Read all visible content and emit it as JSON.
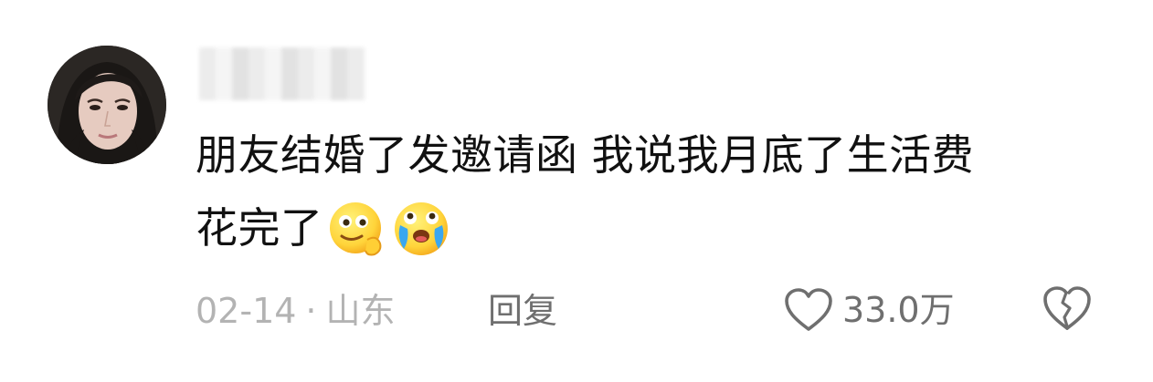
{
  "comment": {
    "username": "",
    "text_line_1": "朋友结婚了发邀请函 我说我月底了生活费",
    "text_line_2": "花完了",
    "emojis": [
      "thinking-face-emoji",
      "crying-laugh-emoji"
    ],
    "date": "02-14",
    "separator": "·",
    "location": "山东",
    "reply_label": "回复",
    "like_count": "33.0万"
  },
  "colors": {
    "text_primary": "#111111",
    "text_meta": "#b3b3b3",
    "text_action": "#6f6f6f",
    "background": "#ffffff"
  },
  "icons": {
    "like": "heart-outline-icon",
    "dislike": "broken-heart-outline-icon"
  }
}
